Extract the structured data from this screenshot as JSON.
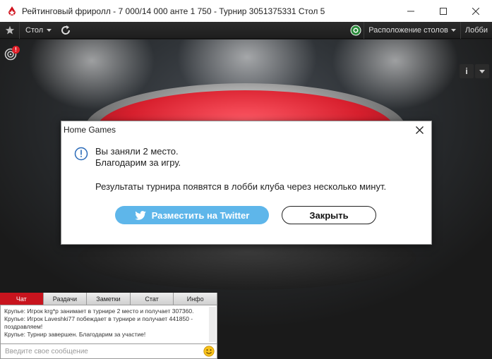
{
  "window": {
    "title": "Рейтинговый фриролл - 7 000/14 000 анте 1 750 - Турнир 3051375331 Стол 5"
  },
  "toolbar": {
    "table_menu": "Стол",
    "layout_menu": "Расположение столов",
    "lobby": "Лобби"
  },
  "scene": {
    "badge": "!",
    "info_tab": "i"
  },
  "dialog": {
    "title": "Home Games",
    "line1": "Вы заняли 2 место.",
    "line2": "Благодарим за игру.",
    "line3": "Результаты турнира появятся в лобби клуба через несколько минут.",
    "twitter_button": "Разместить на Twitter",
    "close_button": "Закрыть"
  },
  "chat": {
    "tabs": [
      "Чат",
      "Раздачи",
      "Заметки",
      "Стат",
      "Инфо"
    ],
    "messages": [
      "Крупье: Игрок krg*p занимает в турнире 2 место и получает 307360.",
      "Крупье: Игрок Laveshki77 побеждает в турнире и получает 441850 - поздравляем!",
      "Крупье: Турнир завершен. Благодарим за участие!"
    ],
    "input_placeholder": "Введите свое сообщение"
  },
  "colors": {
    "felt": "#d8202e",
    "twitter": "#5eb6ea",
    "chat_active": "#c8141e"
  }
}
